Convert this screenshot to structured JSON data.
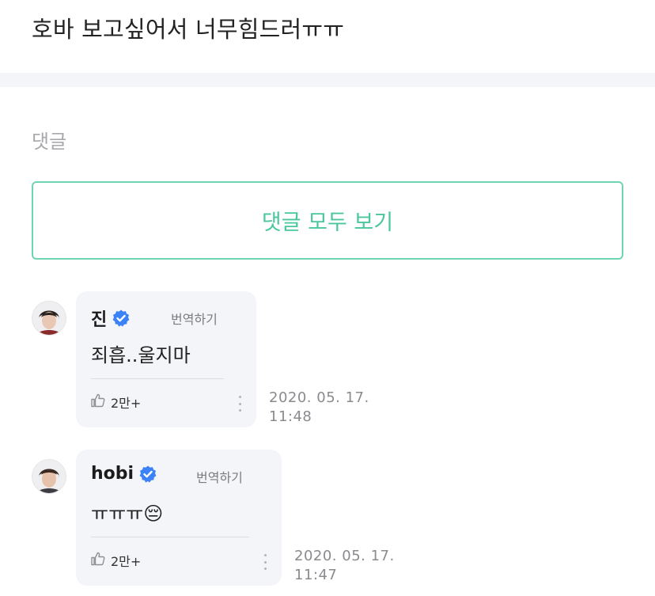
{
  "post": {
    "text": "호바 보고싶어서 너무힘드러ㅠㅠ"
  },
  "comments_section": {
    "title": "댓글",
    "view_all_label": "댓글 모두 보기"
  },
  "comments": [
    {
      "author": "진",
      "verified": true,
      "translate_label": "번역하기",
      "text": "죄흡..울지마",
      "likes": "2만+",
      "date": "2020. 05. 17.",
      "time": "11:48"
    },
    {
      "author": "hobi",
      "verified": true,
      "translate_label": "번역하기",
      "text": "ㅠㅠㅠ😔",
      "likes": "2만+",
      "date": "2020. 05. 17.",
      "time": "11:47"
    }
  ],
  "colors": {
    "accent": "#4ac79c",
    "accent_border": "#6fd5b0",
    "verified_blue": "#3b82f6",
    "bubble_bg": "#f4f5f8"
  },
  "icons": {
    "verified": "verified-check-icon",
    "like": "thumbs-up-icon",
    "more": "more-vertical-icon",
    "avatar": "avatar"
  }
}
